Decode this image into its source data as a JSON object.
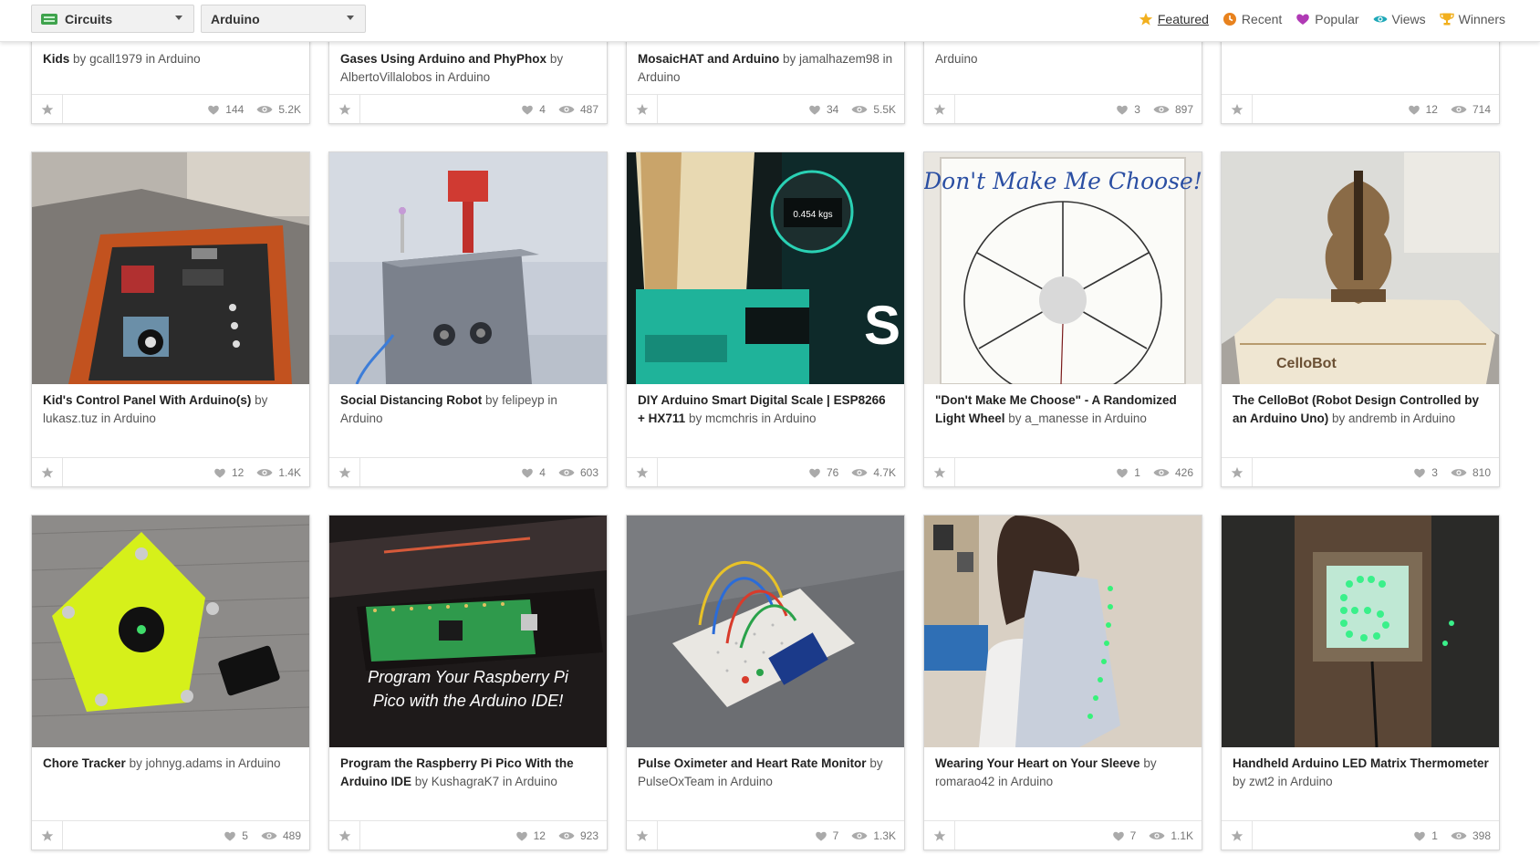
{
  "filters": {
    "category": "Circuits",
    "channel": "Arduino"
  },
  "sort_nav": [
    {
      "label": "Featured",
      "icon": "star-icon",
      "color": "#f2b01e"
    },
    {
      "label": "Recent",
      "icon": "clock-icon",
      "color": "#e8821e"
    },
    {
      "label": "Popular",
      "icon": "heart-icon",
      "color": "#b03ab5"
    },
    {
      "label": "Views",
      "icon": "eye-icon",
      "color": "#1fa8b8"
    },
    {
      "label": "Winners",
      "icon": "trophy-icon",
      "color": "#f2b01e"
    }
  ],
  "top_row": [
    {
      "title": "Kids",
      "by": "by",
      "author": "gcall1979",
      "in": "in",
      "channel": "Arduino",
      "favorites": "144",
      "views": "5.2K"
    },
    {
      "title": "Gases Using Arduino and PhyPhox",
      "by": "by",
      "author": "AlbertoVillalobos",
      "in": "in",
      "channel": "Arduino",
      "favorites": "4",
      "views": "487"
    },
    {
      "title": "MosaicHAT and Arduino",
      "by": "by",
      "author": "jamalhazem98",
      "in": "in",
      "channel": "Arduino",
      "favorites": "34",
      "views": "5.5K"
    },
    {
      "title": "",
      "by": "",
      "author": "",
      "in": "",
      "channel": "Arduino",
      "favorites": "3",
      "views": "897"
    },
    {
      "title": "",
      "by": "",
      "author": "",
      "in": "",
      "channel": "",
      "favorites": "12",
      "views": "714"
    }
  ],
  "middle_row": [
    {
      "title": "Kid's Control Panel With Arduino(s)",
      "by": "by",
      "author": "lukasz.tuz",
      "in": "in",
      "channel": "Arduino",
      "favorites": "12",
      "views": "1.4K"
    },
    {
      "title": "Social Distancing Robot",
      "by": "by",
      "author": "felipeyp",
      "in": "in",
      "channel": "Arduino",
      "favorites": "4",
      "views": "603"
    },
    {
      "title": "DIY Arduino Smart Digital Scale | ESP8266 + HX711",
      "by": "by",
      "author": "mcmchris",
      "in": "in",
      "channel": "Arduino",
      "favorites": "76",
      "views": "4.7K",
      "overlay_text": "0.454 kgs"
    },
    {
      "title": "\"Don't Make Me Choose\" - A Randomized Light Wheel",
      "by": "by",
      "author": "a_manesse",
      "in": "in",
      "channel": "Arduino",
      "favorites": "1",
      "views": "426",
      "overlay_text": "Don't Make Me Choose!"
    },
    {
      "title": "The CelloBot (Robot Design Controlled by an Arduino Uno)",
      "by": "by",
      "author": "andremb",
      "in": "in",
      "channel": "Arduino",
      "favorites": "3",
      "views": "810",
      "overlay_text": "CelloBot"
    }
  ],
  "bottom_row": [
    {
      "title": "Chore Tracker",
      "by": "by",
      "author": "johnyg.adams",
      "in": "in",
      "channel": "Arduino",
      "favorites": "5",
      "views": "489"
    },
    {
      "title": "Program the Raspberry Pi Pico With the Arduino IDE",
      "by": "by",
      "author": "KushagraK7",
      "in": "in",
      "channel": "Arduino",
      "favorites": "12",
      "views": "923",
      "overlay_text": "Program Your Raspberry Pi Pico with the Arduino IDE!"
    },
    {
      "title": "Pulse Oximeter and Heart Rate Monitor",
      "by": "by",
      "author": "PulseOxTeam",
      "in": "in",
      "channel": "Arduino",
      "favorites": "7",
      "views": "1.3K"
    },
    {
      "title": "Wearing Your Heart on Your Sleeve",
      "by": "by",
      "author": "romarao42",
      "in": "in",
      "channel": "Arduino",
      "favorites": "7",
      "views": "1.1K"
    },
    {
      "title": "Handheld Arduino LED Matrix Thermometer",
      "by": "by",
      "author": "zwt2",
      "in": "in",
      "channel": "Arduino",
      "favorites": "1",
      "views": "398"
    }
  ]
}
